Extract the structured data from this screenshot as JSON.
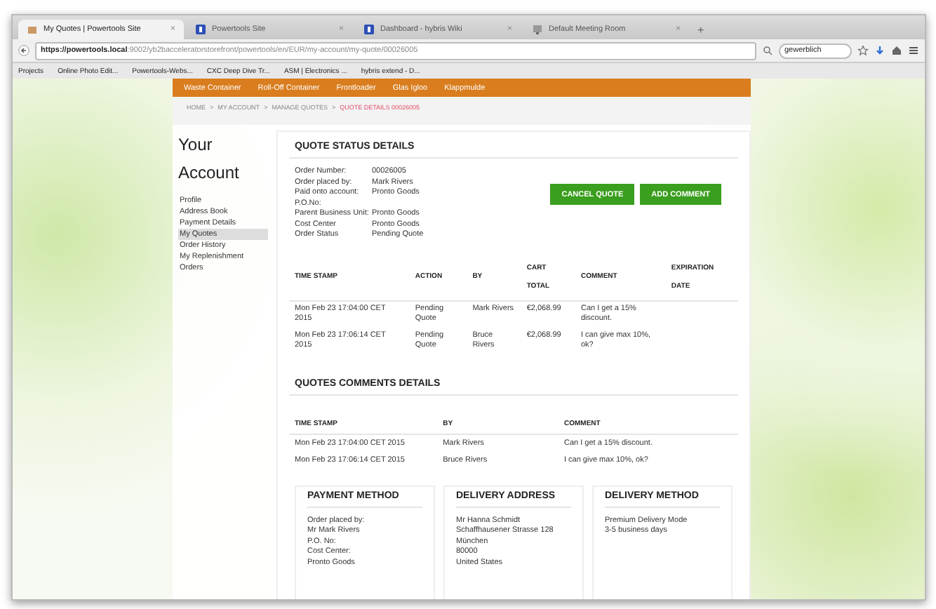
{
  "browser": {
    "tabs": [
      {
        "title": "My Quotes | Powertools Site",
        "close": "×",
        "selected": true
      },
      {
        "title": "Powertools Site",
        "close": "×",
        "selected": false
      },
      {
        "title": "Dashboard - hybris Wiki",
        "close": "×",
        "selected": false
      },
      {
        "title": "Default Meeting Room",
        "close": "×",
        "selected": false
      }
    ],
    "new_tab": "+",
    "url_host": "https://powertools.local",
    "url_path": ":9002/yb2bacceleratorstorefront/powertools/en/EUR/my-account/my-quote/00026005",
    "search": {
      "value": "gewerblich"
    },
    "bookmarks": [
      "Projects",
      "Online Photo Edit...",
      "Powertools-Webs...",
      "CXC Deep Dive Tr...",
      "ASM | Electronics ...",
      "hybris extend - D..."
    ]
  },
  "nav": [
    "Waste Container",
    "Roll-Off Container",
    "Frontloader",
    "Glas Igloo",
    "Klappmulde"
  ],
  "breadcrumb": [
    {
      "label": "HOME",
      "current": false
    },
    {
      "label": "MY ACCOUNT",
      "current": false
    },
    {
      "label": "MANAGE QUOTES",
      "current": false
    },
    {
      "label": "QUOTE DETAILS 00026005",
      "current": true
    }
  ],
  "breadcrumb_separator": ">",
  "sidebar": {
    "title": "Your Account",
    "items": [
      {
        "label": "Profile",
        "selected": false
      },
      {
        "label": "Address Book",
        "selected": false
      },
      {
        "label": "Payment Details",
        "selected": false
      },
      {
        "label": "My Quotes",
        "selected": true
      },
      {
        "label": "Order History",
        "selected": false
      },
      {
        "label": "My Replenishment Orders",
        "selected": false
      }
    ]
  },
  "quote_status": {
    "title": "QUOTE STATUS DETAILS",
    "fields": [
      {
        "label": "Order Number:",
        "value": "00026005"
      },
      {
        "label": "Order placed by:",
        "value": "Mark Rivers"
      },
      {
        "label": "Paid onto account:",
        "value": "Pronto Goods"
      },
      {
        "label": "P.O.No:"
      },
      {
        "label": "Parent Business Unit:",
        "value": "Pronto Goods"
      },
      {
        "label": "Cost Center",
        "value": "Pronto Goods"
      },
      {
        "label": "Order Status",
        "value": "Pending Quote"
      }
    ],
    "buttons": [
      "CANCEL QUOTE",
      "ADD COMMENT"
    ]
  },
  "history": {
    "columns": [
      "TIME STAMP",
      "ACTION",
      "BY",
      "CART TOTAL",
      "COMMENT",
      "EXPIRATION DATE"
    ],
    "rows": [
      [
        "Mon Feb 23 17:04:00 CET 2015",
        "Pending Quote",
        "Mark Rivers",
        "€2,068.99",
        "Can I get a 15% discount.",
        ""
      ],
      [
        "Mon Feb 23 17:06:14 CET 2015",
        "Pending Quote",
        "Bruce Rivers",
        "€2,068.99",
        "I can give max 10%, ok?",
        ""
      ]
    ]
  },
  "comments": {
    "title": "QUOTES COMMENTS DETAILS",
    "columns": [
      "TIME STAMP",
      "BY",
      "COMMENT"
    ],
    "rows": [
      [
        "Mon Feb 23 17:04:00 CET 2015",
        "Mark Rivers",
        "Can I get a 15% discount."
      ],
      [
        "Mon Feb 23 17:06:14 CET 2015",
        "Bruce Rivers",
        "I can give max 10%, ok?"
      ]
    ]
  },
  "info_cards": [
    {
      "title": "PAYMENT METHOD",
      "lines": [
        "Order placed by: Mr Mark Rivers",
        "P.O. No:",
        "Cost Center: Pronto Goods"
      ]
    },
    {
      "title": "DELIVERY ADDRESS",
      "lines": [
        "Mr Hanna Schmidt",
        "Schaffhausener Strasse 128",
        "München",
        "80000",
        "United States"
      ]
    },
    {
      "title": "DELIVERY METHOD",
      "lines": [
        "Premium Delivery Mode",
        "3-5 business days"
      ]
    }
  ]
}
